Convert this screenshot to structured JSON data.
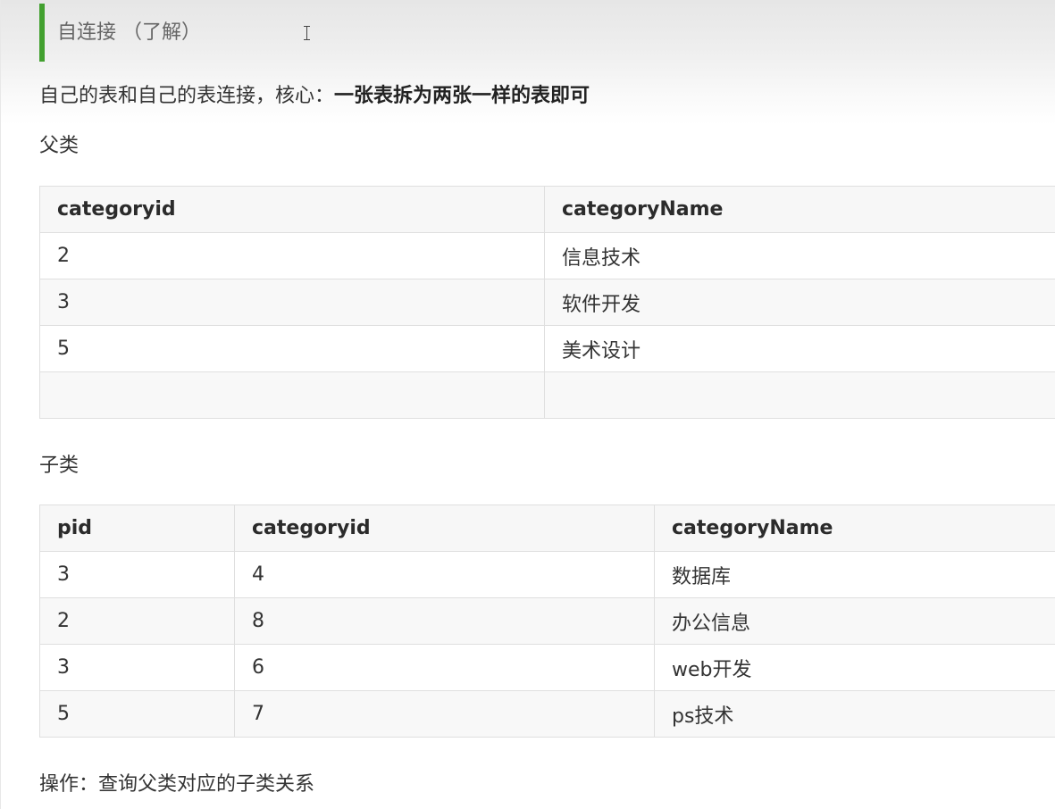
{
  "blockquote": {
    "text": "自连接 （了解）",
    "accent_color": "#42a02f"
  },
  "intro": {
    "text": "自己的表和自己的表连接，核心：",
    "bold": "一张表拆为两张一样的表即可"
  },
  "parent_section": {
    "heading": "父类",
    "table": {
      "columns": [
        "categoryid",
        "categoryName"
      ],
      "rows": [
        [
          "2",
          "信息技术"
        ],
        [
          "3",
          "软件开发"
        ],
        [
          "5",
          "美术设计"
        ],
        [
          "",
          ""
        ]
      ]
    }
  },
  "child_section": {
    "heading": "子类",
    "table": {
      "columns": [
        "pid",
        "categoryid",
        "categoryName"
      ],
      "rows": [
        [
          "3",
          "4",
          "数据库"
        ],
        [
          "2",
          "8",
          "办公信息"
        ],
        [
          "3",
          "6",
          "web开发"
        ],
        [
          "5",
          "7",
          "ps技术"
        ]
      ]
    }
  },
  "operation": {
    "text": "操作：查询父类对应的子类关系"
  }
}
